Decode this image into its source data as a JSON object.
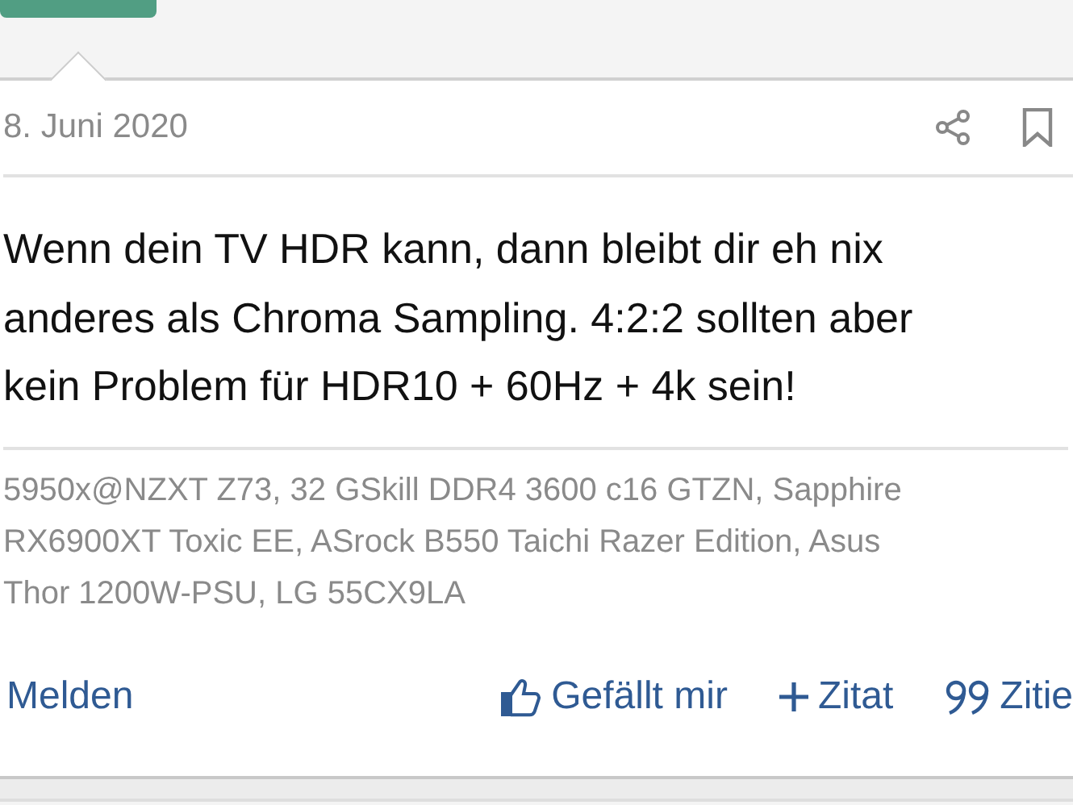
{
  "post": {
    "date": "8. Juni 2020",
    "message": "Wenn dein TV HDR kann, dann bleibt dir eh nix anderes als Chroma Sampling. 4:2:2 sollten aber kein Problem für HDR10 + 60Hz + 4k sein!",
    "signature": [
      "5950x@NZXT Z73, 32 GSkill DDR4 3600 c16 GTZN, Sapphire",
      "RX6900XT Toxic EE, ASrock B550 Taichi Razer Edition, Asus",
      "Thor 1200W-PSU, LG 55CX9LA"
    ],
    "report_link": "Melden",
    "actions": [
      {
        "kind": "like",
        "label": "Gefällt mir"
      },
      {
        "kind": "add",
        "label": "Zitat"
      },
      {
        "kind": "quote",
        "label": "Zitie"
      }
    ]
  }
}
